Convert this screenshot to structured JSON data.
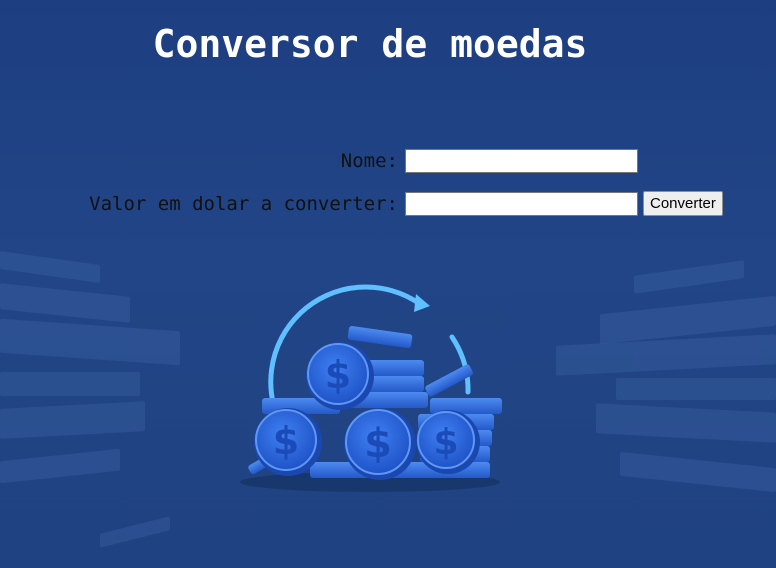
{
  "header": {
    "title": "Conversor de moedas"
  },
  "form": {
    "name_label": "Nome:",
    "name_value": "",
    "amount_label": "Valor em dolar a converter:",
    "amount_value": "",
    "convert_button": "Converter"
  },
  "colors": {
    "background": "#1f4080",
    "title": "#ffffff",
    "label": "#111111",
    "coin": "#2f6be0",
    "arrow": "#5fbfff"
  },
  "illustration": {
    "icon": "coins-with-dollar-and-circular-arrow-icon"
  }
}
